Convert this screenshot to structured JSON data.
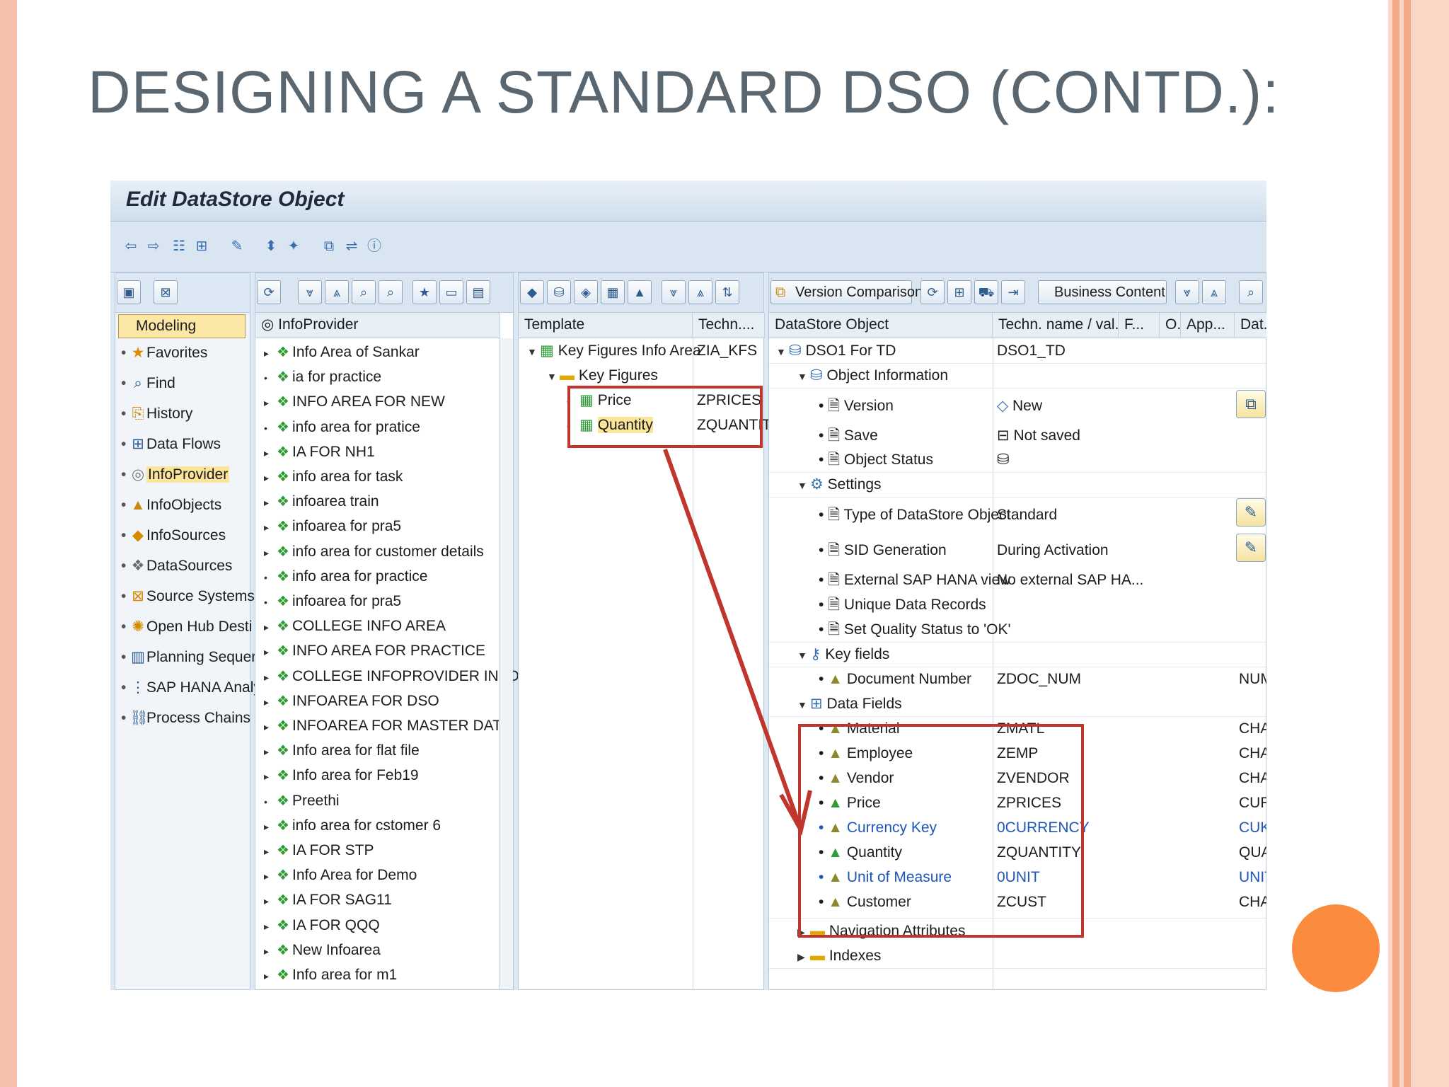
{
  "slide": {
    "title": "DESIGNING A STANDARD DSO (CONTD.):"
  },
  "window": {
    "title": "Edit DataStore Object"
  },
  "colors": {
    "accent_red": "#c0362c",
    "selection_yellow": "#fbe59a",
    "orange_circle": "#fb8b3f",
    "peach_border": "#f6c1ac"
  },
  "nav": {
    "button_label": "Modeling",
    "items": [
      {
        "label": "Favorites",
        "icon": "star-icon"
      },
      {
        "label": "Find",
        "icon": "binoculars-icon"
      },
      {
        "label": "History",
        "icon": "history-icon"
      },
      {
        "label": "Data Flows",
        "icon": "data-flow-icon"
      },
      {
        "label": "InfoProvider",
        "icon": "infoprovider-icon",
        "selected": true
      },
      {
        "label": "InfoObjects",
        "icon": "infoobject-icon"
      },
      {
        "label": "InfoSources",
        "icon": "infosource-icon"
      },
      {
        "label": "DataSources",
        "icon": "datasource-icon"
      },
      {
        "label": "Source Systems",
        "icon": "source-system-icon"
      },
      {
        "label": "Open Hub Desti",
        "icon": "open-hub-icon"
      },
      {
        "label": "Planning Sequer",
        "icon": "planning-icon"
      },
      {
        "label": "SAP HANA Analy",
        "icon": "hana-icon"
      },
      {
        "label": "Process Chains",
        "icon": "process-chain-icon"
      }
    ]
  },
  "infoprovider_tree": {
    "header": "InfoProvider",
    "items": [
      "Info Area of Sankar",
      "ia for practice",
      "INFO AREA FOR NEW",
      "info area for  pratice",
      "IA FOR NH1",
      "info area for task",
      "infoarea train",
      "infoarea for pra5",
      "info area for customer details",
      "info area for practice",
      "infoarea for pra5",
      "COLLEGE INFO AREA",
      "INFO AREA FOR PRACTICE",
      "COLLEGE INFOPROVIDER INFO ARE",
      "INFOAREA FOR DSO",
      "INFOAREA FOR MASTER DATA",
      "Info area for flat file",
      "Info area for Feb19",
      "Preethi",
      "info area for cstomer 6",
      "IA FOR STP",
      "Info Area for Demo",
      "IA FOR SAG11",
      "IA FOR QQQ",
      "New Infoarea",
      "Info area for m1"
    ]
  },
  "template": {
    "col_template": "Template",
    "col_techn": "Techn....",
    "rows": [
      {
        "label": "Key Figures Info Area",
        "techn": "ZIA_KFS",
        "level": 0,
        "expanded": true
      },
      {
        "label": "Key Figures",
        "techn": "",
        "level": 1,
        "expanded": true
      },
      {
        "label": "Price",
        "techn": "ZPRICES",
        "level": 2
      },
      {
        "label": "Quantity",
        "techn": "ZQUANTIT",
        "level": 2,
        "selected": true
      }
    ]
  },
  "dso": {
    "toolbar": {
      "version_comparison": "Version Comparison",
      "business_content": "Business Content"
    },
    "columns": {
      "object": "DataStore Object",
      "techn": "Techn. name / val...",
      "f": "F...",
      "o": "O.",
      "app": "App...",
      "dat": "Dat..."
    },
    "root": {
      "label": "DSO1 For TD",
      "techn": "DSO1_TD"
    },
    "object_information": {
      "label": "Object Information",
      "version_label": "Version",
      "version_value": "New",
      "save_label": "Save",
      "save_value": "Not saved",
      "status_label": "Object Status"
    },
    "settings": {
      "label": "Settings",
      "type_label": "Type of DataStore Object",
      "type_value": "Standard",
      "sid_label": "SID Generation",
      "sid_value": "During Activation",
      "hana_label": "External SAP HANA view",
      "hana_value": "No external SAP HA...",
      "unique_label": "Unique Data Records",
      "quality_label": "Set Quality Status to 'OK'"
    },
    "key_fields": {
      "label": "Key fields",
      "items": [
        {
          "label": "Document Number",
          "techn": "ZDOC_NUM",
          "dtype": "NUMC"
        }
      ]
    },
    "data_fields": {
      "label": "Data Fields",
      "items": [
        {
          "label": "Material",
          "techn": "ZMATL",
          "dtype": "CHAR",
          "link": false
        },
        {
          "label": "Employee",
          "techn": "ZEMP",
          "dtype": "CHAR",
          "link": false
        },
        {
          "label": "Vendor",
          "techn": "ZVENDOR",
          "dtype": "CHAR",
          "link": false
        },
        {
          "label": "Price",
          "techn": "ZPRICES",
          "dtype": "CURR",
          "link": false
        },
        {
          "label": "Currency Key",
          "techn": "0CURRENCY",
          "dtype": "CUKY",
          "link": true
        },
        {
          "label": "Quantity",
          "techn": "ZQUANTITY",
          "dtype": "QUAN",
          "link": false
        },
        {
          "label": "Unit of Measure",
          "techn": "0UNIT",
          "dtype": "UNIT",
          "link": true
        },
        {
          "label": "Customer",
          "techn": "ZCUST",
          "dtype": "CHAR",
          "link": false
        }
      ]
    },
    "navigation_attributes": "Navigation Attributes",
    "indexes": "Indexes"
  }
}
